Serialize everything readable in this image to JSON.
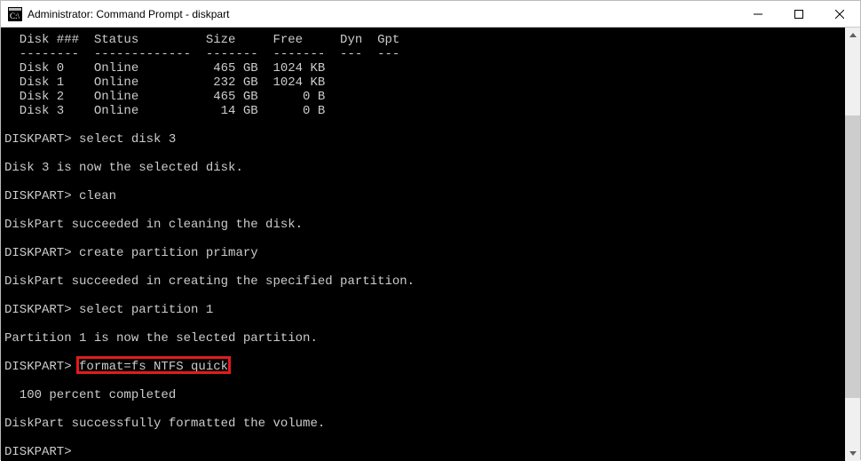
{
  "titlebar": {
    "title": "Administrator: Command Prompt - diskpart"
  },
  "console": {
    "lines": [
      "  Disk ###  Status         Size     Free     Dyn  Gpt",
      "  --------  -------------  -------  -------  ---  ---",
      "  Disk 0    Online          465 GB  1024 KB",
      "  Disk 1    Online          232 GB  1024 KB",
      "  Disk 2    Online          465 GB      0 B",
      "  Disk 3    Online           14 GB      0 B",
      "",
      "DISKPART> select disk 3",
      "",
      "Disk 3 is now the selected disk.",
      "",
      "DISKPART> clean",
      "",
      "DiskPart succeeded in cleaning the disk.",
      "",
      "DISKPART> create partition primary",
      "",
      "DiskPart succeeded in creating the specified partition.",
      "",
      "DISKPART> select partition 1",
      "",
      "Partition 1 is now the selected partition.",
      "",
      "DISKPART> format=fs NTFS quick",
      "",
      "  100 percent completed",
      "",
      "DiskPart successfully formatted the volume.",
      "",
      "DISKPART>"
    ],
    "prompt_index_with_command": 23,
    "prompt_prefix_len": 10,
    "highlighted_command": "format=fs NTFS quick"
  }
}
